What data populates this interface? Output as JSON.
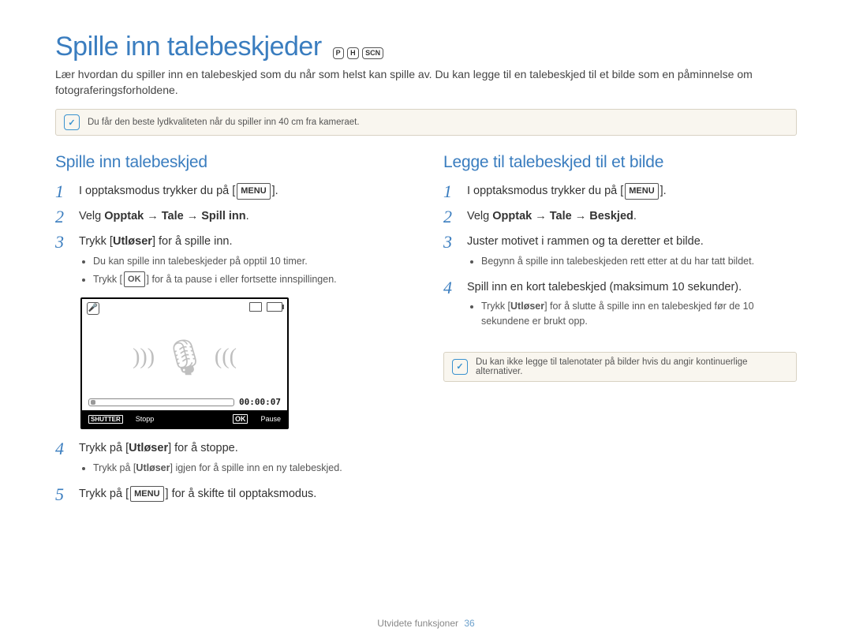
{
  "header": {
    "title": "Spille inn talebeskjeder",
    "mode_icons": [
      "P",
      "H",
      "SCN"
    ]
  },
  "intro": "Lær hvordan du spiller inn en talebeskjed som du når som helst kan spille av. Du kan legge til en talebeskjed til et bilde som en påminnelse om fotograferingsforholdene.",
  "note1": "Du får den beste lydkvaliteten når du spiller inn 40 cm fra kameraet.",
  "left": {
    "heading": "Spille inn talebeskjed",
    "s1a": "I opptaksmodus trykker du på [",
    "s1key": "MENU",
    "s1b": "].",
    "s2a": "Velg ",
    "s2b": "Opptak → Tale → Spill inn",
    "s2c": ".",
    "s3a": "Trykk [",
    "s3b": "Utløser",
    "s3c": "] for å spille inn.",
    "s3_bullets": [
      "Du kan spille inn talebeskjeder på opptil 10 timer.",
      "Trykk [ OK ] for å ta pause i eller fortsette innspillingen."
    ],
    "s3_bullet2_pre": "Trykk [",
    "s3_bullet2_key": "OK",
    "s3_bullet2_post": "] for å ta pause i eller fortsette innspillingen.",
    "lcd_time": "00:00:07",
    "lcd_stop": "Stopp",
    "lcd_pause": "Pause",
    "s4a": "Trykk på [",
    "s4b": "Utløser",
    "s4c": "] for å stoppe.",
    "s4_bullet_pre": "Trykk på [",
    "s4_bullet_b": "Utløser",
    "s4_bullet_post": "] igjen for å spille inn en ny talebeskjed.",
    "s5a": "Trykk på [",
    "s5key": "MENU",
    "s5b": "] for å skifte til opptaksmodus."
  },
  "right": {
    "heading": "Legge til talebeskjed til et bilde",
    "s1a": "I opptaksmodus trykker du på [",
    "s1key": "MENU",
    "s1b": "].",
    "s2a": "Velg ",
    "s2b": "Opptak → Tale → Beskjed",
    "s2c": ".",
    "s3": "Juster motivet i rammen og ta deretter et bilde.",
    "s3_bullet": "Begynn å spille inn talebeskjeden rett etter at du har tatt bildet.",
    "s4": "Spill inn en kort talebeskjed (maksimum 10 sekunder).",
    "s4_bullet_pre": "Trykk [",
    "s4_bullet_b": "Utløser",
    "s4_bullet_post": "] for å slutte å spille inn en talebeskjed før de 10 sekundene er brukt opp."
  },
  "note2": "Du kan ikke legge til talenotater på bilder hvis du angir kontinuerlige alternativer.",
  "footer_section": "Utvidete funksjoner",
  "footer_page": "36"
}
